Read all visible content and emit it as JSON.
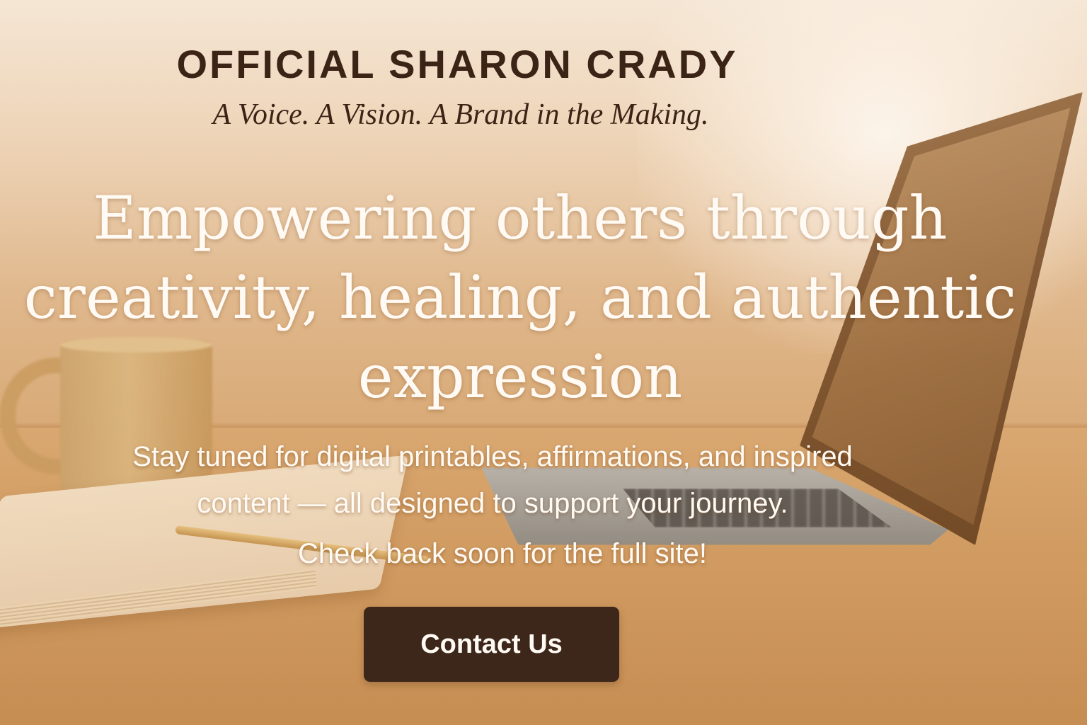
{
  "header": {
    "brand_title": "OFFICIAL SHARON CRADY",
    "tagline": "A Voice. A Vision. A Brand in the Making."
  },
  "hero": {
    "headline_lines": [
      "Empowering others through",
      "creativity, healing, and authentic",
      "expression"
    ],
    "subtext_lines": [
      "Stay tuned for digital printables, affirmations, and inspired",
      "content — all designed to support your journey."
    ],
    "check_back": "Check back soon for the full site!"
  },
  "cta": {
    "contact_label": "Contact Us"
  },
  "colors": {
    "brand_dark_brown": "#3b2416",
    "button_brown": "#3d271a",
    "hero_text": "#fffaf3",
    "background_warm": "#d7a772"
  },
  "background": {
    "scene_items": [
      "coffee-mug",
      "open-notebook",
      "pen",
      "laptop"
    ]
  }
}
